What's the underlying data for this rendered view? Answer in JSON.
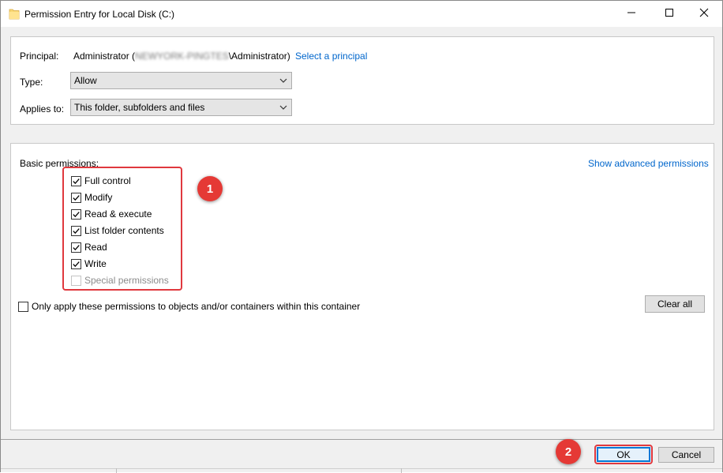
{
  "window": {
    "title": "Permission Entry for Local Disk (C:)"
  },
  "principal": {
    "label": "Principal:",
    "value_prefix": "Administrator (",
    "value_blurred": "NEWYORK-PINGTES",
    "value_suffix": "\\Administrator)",
    "link": "Select a principal"
  },
  "type": {
    "label": "Type:",
    "selected": "Allow"
  },
  "applies_to": {
    "label": "Applies to:",
    "selected": "This folder, subfolders and files"
  },
  "permissions": {
    "heading": "Basic permissions:",
    "advanced_link": "Show advanced permissions",
    "items": [
      {
        "label": "Full control",
        "checked": true,
        "disabled": false
      },
      {
        "label": "Modify",
        "checked": true,
        "disabled": false
      },
      {
        "label": "Read & execute",
        "checked": true,
        "disabled": false
      },
      {
        "label": "List folder contents",
        "checked": true,
        "disabled": false
      },
      {
        "label": "Read",
        "checked": true,
        "disabled": false
      },
      {
        "label": "Write",
        "checked": true,
        "disabled": false
      },
      {
        "label": "Special permissions",
        "checked": false,
        "disabled": true
      }
    ]
  },
  "only_apply": {
    "label": "Only apply these permissions to objects and/or containers within this container",
    "checked": false
  },
  "buttons": {
    "clear_all": "Clear all",
    "ok": "OK",
    "cancel": "Cancel"
  },
  "annotations": {
    "badge_1": "1",
    "badge_2": "2"
  },
  "colors": {
    "accent_link": "#0066cc",
    "annotation_red": "#e53935",
    "focus_blue": "#0078d7"
  }
}
